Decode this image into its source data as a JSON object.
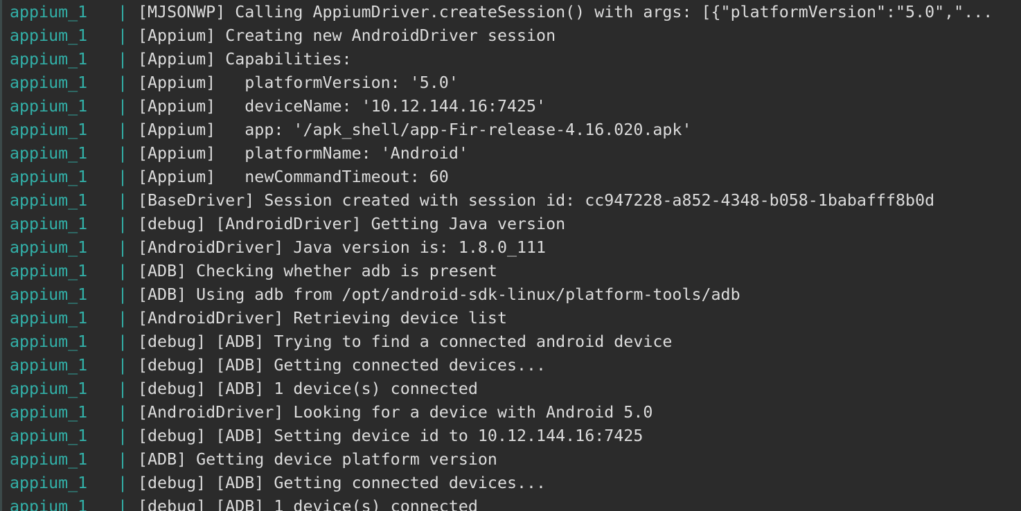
{
  "terminal": {
    "service_name": "appium_1",
    "separator": "|",
    "colors": {
      "background": "#2b2b2b",
      "service": "#32b0a8",
      "text": "#dcdcdc"
    },
    "lines": [
      "[MJSONWP] Calling AppiumDriver.createSession() with args: [{\"platformVersion\":\"5.0\",\"...",
      "[Appium] Creating new AndroidDriver session",
      "[Appium] Capabilities:",
      "[Appium]   platformVersion: '5.0'",
      "[Appium]   deviceName: '10.12.144.16:7425'",
      "[Appium]   app: '/apk_shell/app-Fir-release-4.16.020.apk'",
      "[Appium]   platformName: 'Android'",
      "[Appium]   newCommandTimeout: 60",
      "[BaseDriver] Session created with session id: cc947228-a852-4348-b058-1babafff8b0d",
      "[debug] [AndroidDriver] Getting Java version",
      "[AndroidDriver] Java version is: 1.8.0_111",
      "[ADB] Checking whether adb is present",
      "[ADB] Using adb from /opt/android-sdk-linux/platform-tools/adb",
      "[AndroidDriver] Retrieving device list",
      "[debug] [ADB] Trying to find a connected android device",
      "[debug] [ADB] Getting connected devices...",
      "[debug] [ADB] 1 device(s) connected",
      "[AndroidDriver] Looking for a device with Android 5.0",
      "[debug] [ADB] Setting device id to 10.12.144.16:7425",
      "[ADB] Getting device platform version",
      "[debug] [ADB] Getting connected devices...",
      "[debug] [ADB] 1 device(s) connected"
    ]
  }
}
